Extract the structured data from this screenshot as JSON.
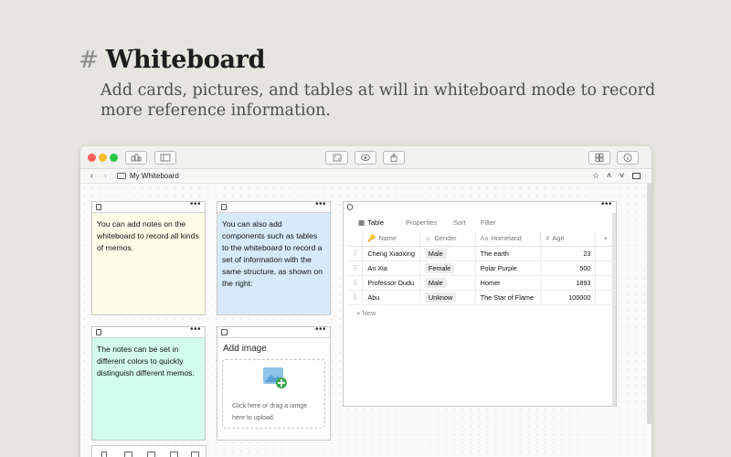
{
  "hero": {
    "hash": "#",
    "title": "Whiteboard",
    "subtitle": "Add cards, pictures, and tables at will in whiteboard mode to record more reference information."
  },
  "window": {
    "traffic_lights": [
      "#fe5f57",
      "#febc2e",
      "#28c840"
    ],
    "toolbar_icons": [
      "hierarchy-icon",
      "sidebar-icon",
      "expand-icon",
      "view-icon",
      "share-icon",
      "grid-icon",
      "info-icon"
    ],
    "nav": {
      "back": "‹",
      "forward": "›",
      "breadcrumb": "My Whiteboard",
      "star": "☆",
      "up": "˄",
      "down": "˅"
    }
  },
  "notes": [
    {
      "text": "You can add notes on the whiteboard to record all kinds of memos.",
      "color": "#fffee8"
    },
    {
      "text": "You can also add components such as tables to the whiteboard to record a set of information with the same structure, as shown on the right:",
      "color": "#d6eafb"
    },
    {
      "text": "The notes can be set in different colors to quickly distinguish different memos.",
      "color": "#d3fcef"
    }
  ],
  "image_card": {
    "title": "Add image",
    "hint": "Click here or drag a iamge here to upload."
  },
  "more_label": "•••",
  "table": {
    "tabs": [
      "Table",
      "Properties",
      "Sort",
      "Filter"
    ],
    "columns": [
      "Name",
      "Gender",
      "Homeland",
      "Age"
    ],
    "column_icons": [
      "🔑",
      "☺",
      "Aa",
      "#"
    ],
    "add_column": "+",
    "rows": [
      {
        "name": "Cheng Xiaoxing",
        "gender": "Male",
        "homeland": "The earth",
        "age": "23"
      },
      {
        "name": "An Xia",
        "gender": "Female",
        "homeland": "Polar Purple",
        "age": "500"
      },
      {
        "name": "Professor Dudu",
        "gender": "Male",
        "homeland": "Homer",
        "age": "1893"
      },
      {
        "name": "Abu",
        "gender": "Unknow",
        "homeland": "The Star of Flame",
        "age": "100000"
      }
    ],
    "new_row": "+ New"
  }
}
